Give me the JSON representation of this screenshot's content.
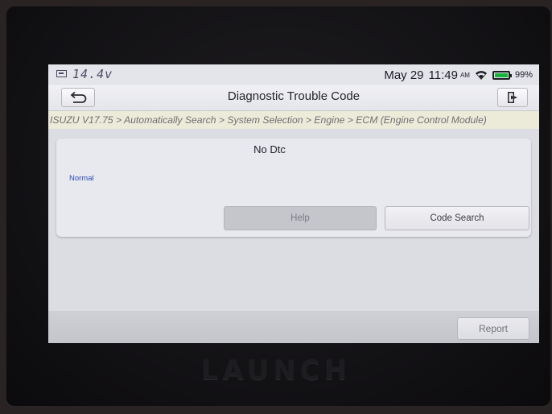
{
  "device": {
    "brand": "LAUNCH"
  },
  "status_bar": {
    "voltage": "14.4v",
    "date": "May 29",
    "time": "11:49",
    "ampm": "AM",
    "battery_percent": "99%",
    "icons": [
      "car-battery-icon",
      "wifi-icon",
      "battery-icon"
    ]
  },
  "header": {
    "title": "Diagnostic Trouble Code",
    "back_icon": "return-arrow-icon",
    "exit_icon": "exit-door-icon"
  },
  "breadcrumb": {
    "text": "ISUZU V17.75 > Automatically Search > System Selection > Engine > ECM (Engine Control Module)"
  },
  "dtc_panel": {
    "title": "No Dtc",
    "status": "Normal",
    "help_label": "Help",
    "code_search_label": "Code Search"
  },
  "footer": {
    "report_label": "Report"
  },
  "colors": {
    "status_text": "#2d4bb8",
    "breadcrumb_bg": "#ecebd9",
    "battery_fill": "#17b33a"
  }
}
